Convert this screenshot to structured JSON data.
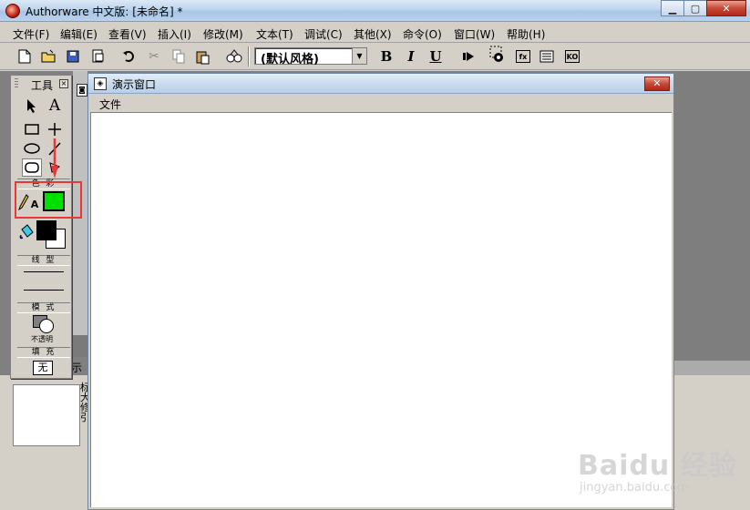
{
  "window": {
    "title": "Authorware 中文版: [未命名] *",
    "min_label": "▁",
    "max_label": "▢",
    "close_label": "✕"
  },
  "menubar": [
    "文件(F)",
    "编辑(E)",
    "查看(V)",
    "插入(I)",
    "修改(M)",
    "文本(T)",
    "调试(C)",
    "其他(X)",
    "命令(O)",
    "窗口(W)",
    "帮助(H)"
  ],
  "toolbar": {
    "style_select_value": "(默认风格)",
    "bold": "B",
    "italic": "I",
    "underline": "U",
    "fn_label": "fx",
    "ko_label": "KO"
  },
  "tools_panel": {
    "title": "工具",
    "text_tool": "A",
    "section_color": "色 彩",
    "text_color_label": "A",
    "section_line": "线 型",
    "section_mode": "模 式",
    "mode_value": "不透明",
    "section_fill": "填 充",
    "fill_value": "无",
    "colors": {
      "text_color": "#00e000",
      "fill_foreground": "#000000",
      "fill_background": "#ffffff"
    }
  },
  "presentation_window": {
    "title": "演示窗口",
    "menu_file": "文件",
    "close_label": "✕"
  },
  "background_panel": {
    "label": "示",
    "chars": [
      "标",
      "大",
      "修",
      "引"
    ]
  },
  "annotation": {
    "color": "#e8383a"
  },
  "watermark": {
    "main": "Baidu 经验",
    "sub": "jingyan.baidu.com"
  }
}
